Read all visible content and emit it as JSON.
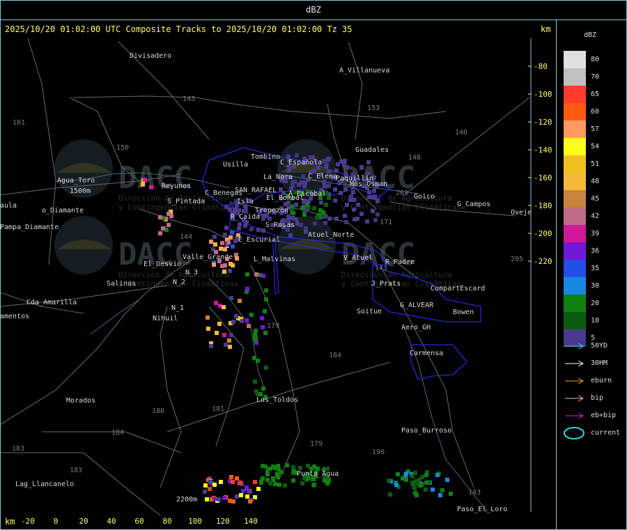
{
  "window": {
    "title": "dBZ"
  },
  "header": {
    "text": "2025/10/20 01:02:00 UTC Composite Tracks to 2025/10/20 01:02:00 Tz 35",
    "units_top": "km",
    "units_bottom": "km"
  },
  "axes": {
    "x_ticks": [
      "-20",
      "0",
      "20",
      "40",
      "60",
      "80",
      "100",
      "120",
      "140"
    ],
    "y_ticks": [
      "-80",
      "-100",
      "-120",
      "-140",
      "-160",
      "-180",
      "-200",
      "-220"
    ]
  },
  "places": [
    "Divisadero",
    "A_Villanueva",
    "Tombino",
    "Usilla",
    "C_Española",
    "La_Nora",
    "C_Elena",
    "Guadales",
    "Paquillin",
    "Mos_Osman",
    "Goico",
    "G_Campos",
    "Oveje",
    "Agua_Toro",
    "1500m",
    "Reyunos",
    "S_Pintada",
    "C_Benegas",
    "SAN_RAFAEL",
    "A_Escobal",
    "Isla",
    "El_Bombal",
    "Tropezon",
    "R_Caida",
    "S_Rosas",
    "Atuel_Norte",
    "E_Escurial",
    "Valle_Grande",
    "L_Malvinas",
    "V_Atuel",
    "R_Padre",
    "El_Desvio",
    "Salinas",
    "N_2",
    "N_3",
    "J_Prats",
    "CompartEscard",
    "G_ALVEAR",
    "Bowen",
    "Soitue",
    "Aero_GH",
    "N_1",
    "Nihuil",
    "Cda_Amarilla",
    "Carmensa",
    "Los_Toldos",
    "Morados",
    "Paso_Burroso",
    "Punta_Agua",
    "Lag_Llancanelo",
    "2200m",
    "Paso_El_Loro",
    "Pampa_Diamante",
    "aula",
    "amentos",
    "o_Diamante"
  ],
  "road_numbers": [
    "143",
    "153",
    "146",
    "148",
    "101",
    "150",
    "203",
    "171",
    "144",
    "179",
    "184",
    "180",
    "179",
    "190",
    "183",
    "184",
    "183",
    "205",
    "143",
    "181",
    "143"
  ],
  "watermark": {
    "brand": "DACC",
    "text1": "Dirección de Agricultura",
    "text2": "y Contingencias Climáticas"
  },
  "legend": {
    "title": "dBZ",
    "scale": [
      {
        "label": "80",
        "color": "#e0e0e0"
      },
      {
        "label": "70",
        "color": "#c0c0c0"
      },
      {
        "label": "65",
        "color": "#ff3b2b"
      },
      {
        "label": "60",
        "color": "#ff5a10"
      },
      {
        "label": "57",
        "color": "#ff9a60"
      },
      {
        "label": "54",
        "color": "#ffff1a"
      },
      {
        "label": "51",
        "color": "#f0c020"
      },
      {
        "label": "48",
        "color": "#f4b83a"
      },
      {
        "label": "45",
        "color": "#c8843c"
      },
      {
        "label": "42",
        "color": "#c06a88"
      },
      {
        "label": "39",
        "color": "#d01898"
      },
      {
        "label": "36",
        "color": "#7018d8"
      },
      {
        "label": "35",
        "color": "#2050e8"
      },
      {
        "label": "30",
        "color": "#1888e0"
      },
      {
        "label": "20",
        "color": "#108010"
      },
      {
        "label": "10",
        "color": "#0c5c10"
      },
      {
        "label": "5",
        "color": "#4a3a8c"
      }
    ],
    "tracks": [
      {
        "label": "50YD",
        "color": "#30d8e8"
      },
      {
        "label": "30HM",
        "color": "#ffffff"
      },
      {
        "label": "eburn",
        "color": "#f0a020"
      },
      {
        "label": "bip",
        "color": "#ffb0c0"
      },
      {
        "label": "eb+bip",
        "color": "#e020e0"
      },
      {
        "label": "current",
        "color": "#30d8e8"
      }
    ]
  }
}
